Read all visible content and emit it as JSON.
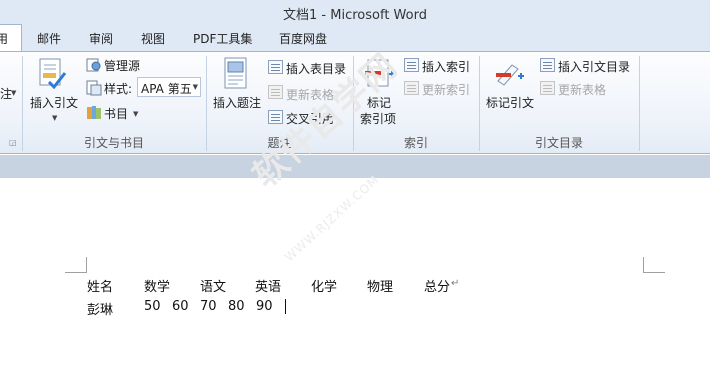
{
  "window": {
    "title": "文档1 - Microsoft Word"
  },
  "tabs": [
    {
      "label": "用",
      "active": true
    },
    {
      "label": "邮件"
    },
    {
      "label": "审阅"
    },
    {
      "label": "视图"
    },
    {
      "label": "PDF工具集"
    },
    {
      "label": "百度网盘"
    }
  ],
  "ribbon": {
    "partial_left": {
      "label": "注"
    },
    "citations": {
      "insert_citation": "插入引文",
      "manage_sources": "管理源",
      "style_label": "样式:",
      "style_value": "APA 第五",
      "bibliography": "书目",
      "group_label": "引文与书目"
    },
    "captions": {
      "insert_caption": "插入题注",
      "insert_table_of_figures": "插入表目录",
      "update_table": "更新表格",
      "cross_reference": "交叉引用",
      "group_label": "题注"
    },
    "index": {
      "mark_entry_line1": "标记",
      "mark_entry_line2": "索引项",
      "insert_index": "插入索引",
      "update_index": "更新索引",
      "group_label": "索引"
    },
    "toa": {
      "mark_citation": "标记引文",
      "insert_toa": "插入引文目录",
      "update_table": "更新表格",
      "group_label": "引文目录"
    }
  },
  "document": {
    "headers": [
      "姓名",
      "数学",
      "语文",
      "英语",
      "化学",
      "物理",
      "总分"
    ],
    "row": [
      "彭琳",
      "50",
      "60",
      "70",
      "80",
      "90"
    ],
    "paragraph_mark": "↵"
  },
  "watermark": {
    "main": "软件自学网",
    "sub": "WWW.RJZXW.COM"
  },
  "colors": {
    "title_bg": "#dfe9f5",
    "ribbon_border": "#9fb6d3",
    "band": "#c8d3e2"
  }
}
